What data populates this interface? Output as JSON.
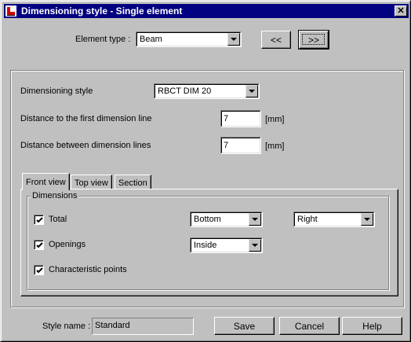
{
  "window": {
    "title": "Dimensioning style - Single element",
    "close_glyph": "✕"
  },
  "element_type": {
    "label": "Element type :",
    "value": "Beam",
    "prev_label": "<<",
    "next_label": ">>"
  },
  "style_settings": {
    "dimensioning_style_label": "Dimensioning style",
    "dimensioning_style_value": "RBCT DIM 20",
    "first_distance_label": "Distance to the first dimension line",
    "first_distance_value": "7",
    "first_distance_unit": "[mm]",
    "between_distance_label": "Distance between dimension lines",
    "between_distance_value": "7",
    "between_distance_unit": "[mm]"
  },
  "tabs": [
    {
      "label": "Front view",
      "active": true
    },
    {
      "label": "Top view",
      "active": false
    },
    {
      "label": "Section",
      "active": false
    }
  ],
  "dimensions": {
    "legend": "Dimensions",
    "total": {
      "label": "Total",
      "checked": true,
      "position": "Bottom",
      "side": "Right"
    },
    "openings": {
      "label": "Openings",
      "checked": true,
      "placement": "Inside"
    },
    "characteristic_points": {
      "label": "Characteristic points",
      "checked": true
    }
  },
  "footer": {
    "style_name_label": "Style name :",
    "style_name_value": "Standard",
    "save_label": "Save",
    "cancel_label": "Cancel",
    "help_label": "Help"
  },
  "colors": {
    "titlebar": "#000080",
    "face": "#c0c0c0"
  },
  "icons": {
    "app": "app-icon",
    "close": "close-icon",
    "dropdown": "chevron-down-icon",
    "check": "check-icon"
  }
}
